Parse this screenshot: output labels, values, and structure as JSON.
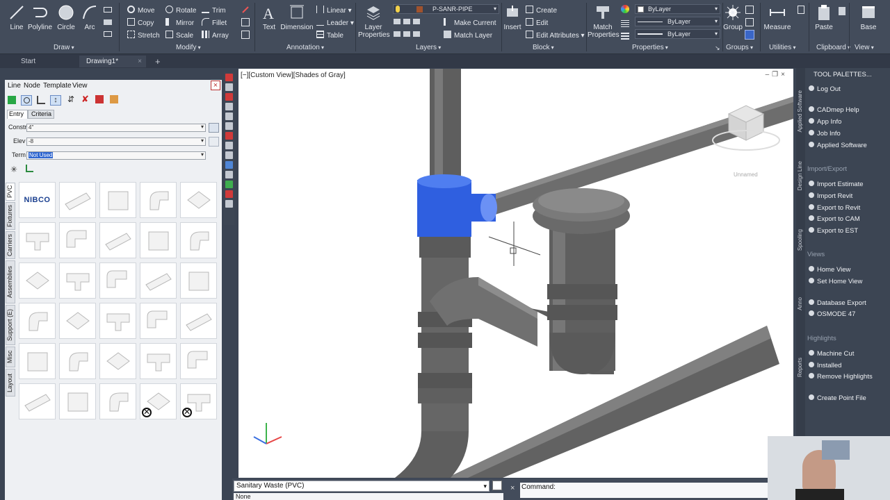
{
  "ribbon": {
    "draw": {
      "label": "Draw",
      "line": "Line",
      "polyline": "Polyline",
      "circle": "Circle",
      "arc": "Arc"
    },
    "modify": {
      "label": "Modify",
      "move": "Move",
      "copy": "Copy",
      "stretch": "Stretch",
      "rotate": "Rotate",
      "mirror": "Mirror",
      "scale": "Scale",
      "trim": "Trim",
      "fillet": "Fillet",
      "array": "Array"
    },
    "annotation": {
      "label": "Annotation",
      "text": "Text",
      "dimension": "Dimension",
      "linear": "Linear",
      "leader": "Leader",
      "table": "Table"
    },
    "layers": {
      "label": "Layers",
      "layer_properties": "Layer Properties",
      "current_layer": "P-SANR-PIPE",
      "make_current": "Make Current",
      "match_layer": "Match Layer"
    },
    "block": {
      "label": "Block",
      "insert": "Insert",
      "create": "Create",
      "edit": "Edit",
      "edit_attributes": "Edit Attributes"
    },
    "properties": {
      "label": "Properties",
      "match_properties": "Match Properties",
      "color": "ByLayer",
      "linetype": "ByLayer",
      "lineweight": "ByLayer"
    },
    "groups": {
      "label": "Groups",
      "group": "Group"
    },
    "utilities": {
      "label": "Utilities",
      "measure": "Measure"
    },
    "clipboard": {
      "label": "Clipboard",
      "paste": "Paste"
    },
    "view": {
      "label": "View",
      "base": "Base"
    }
  },
  "tabs": {
    "start": "Start",
    "drawing": "Drawing1*"
  },
  "left_palette": {
    "menu": [
      "Line",
      "Node",
      "Template",
      "View"
    ],
    "subtabs": [
      "Entry",
      "Criteria"
    ],
    "constr_label": "Constr",
    "constr_value": "4\"",
    "elev_label": "Elev",
    "elev_value": "-8",
    "term_label": "Term",
    "term_value": "Not Used",
    "side_tabs": [
      "PVC",
      "Fixtures",
      "Carriers",
      "Assemblies",
      "Support (E)",
      "Misc",
      "Layout"
    ],
    "brand": "NIBCO"
  },
  "viewport": {
    "label": "[−][Custom View][Shades of Gray]",
    "viewcube_name": "Unnamed"
  },
  "right_palette": {
    "title": "TOOL PALETTES...",
    "vertical_tabs": [
      "Applied Software",
      "Design Line",
      "Spooling",
      "Anno",
      "Reports"
    ],
    "groups": [
      {
        "head": "",
        "items": [
          "Log Out"
        ]
      },
      {
        "head": "",
        "items": [
          "CADmep Help",
          "App Info",
          "Job Info",
          "Applied Software"
        ]
      },
      {
        "head": "Import/Export",
        "items": [
          "Import Estimate",
          "Import Revit",
          "Export to Revit",
          "Export to CAM",
          "Export to EST"
        ]
      },
      {
        "head": "Views",
        "items": [
          "Home View",
          "Set Home View"
        ]
      },
      {
        "head": "",
        "items": [
          "Database Export",
          "OSMODE 47"
        ]
      },
      {
        "head": "Highlights",
        "items": [
          "Machine Cut",
          "Installed",
          "Remove Highlights"
        ]
      },
      {
        "head": "",
        "items": [
          "Create Point File"
        ]
      }
    ]
  },
  "bottom": {
    "service": "Sanitary Waste (PVC)",
    "none": "None",
    "command": "Command:"
  },
  "colors": {
    "selection": "#2f5fe0",
    "pipe": "#6a6a6a",
    "ribbon": "#434c5b"
  }
}
